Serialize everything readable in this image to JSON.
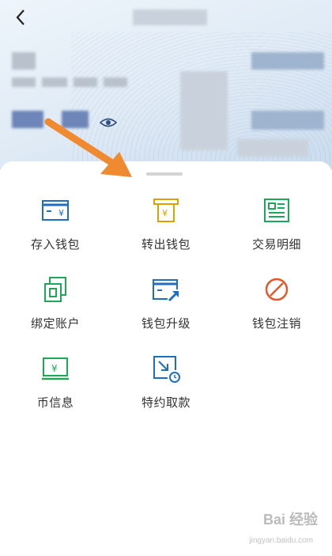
{
  "header": {
    "back_icon": "chevron-left-icon"
  },
  "menu": {
    "items": [
      {
        "label": "存入钱包",
        "icon": "deposit-wallet-icon",
        "color": "#1f6fc1"
      },
      {
        "label": "转出钱包",
        "icon": "withdraw-wallet-icon",
        "color": "#e0a100"
      },
      {
        "label": "交易明细",
        "icon": "transaction-details-icon",
        "color": "#1aaa55"
      },
      {
        "label": "绑定账户",
        "icon": "bind-account-icon",
        "color": "#1aaa55"
      },
      {
        "label": "钱包升级",
        "icon": "wallet-upgrade-icon",
        "color": "#1f6fc1"
      },
      {
        "label": "钱包注销",
        "icon": "wallet-cancel-icon",
        "color": "#e05a2b"
      },
      {
        "label": "币信息",
        "icon": "currency-info-icon",
        "color": "#1aaa55"
      },
      {
        "label": "特约取款",
        "icon": "special-withdrawal-icon",
        "color": "#1f6fc1"
      }
    ]
  },
  "annotation": {
    "arrow_color": "#f08a30"
  },
  "watermark": {
    "text": "Bai 经验",
    "url": "jingyan.baidu.com"
  }
}
